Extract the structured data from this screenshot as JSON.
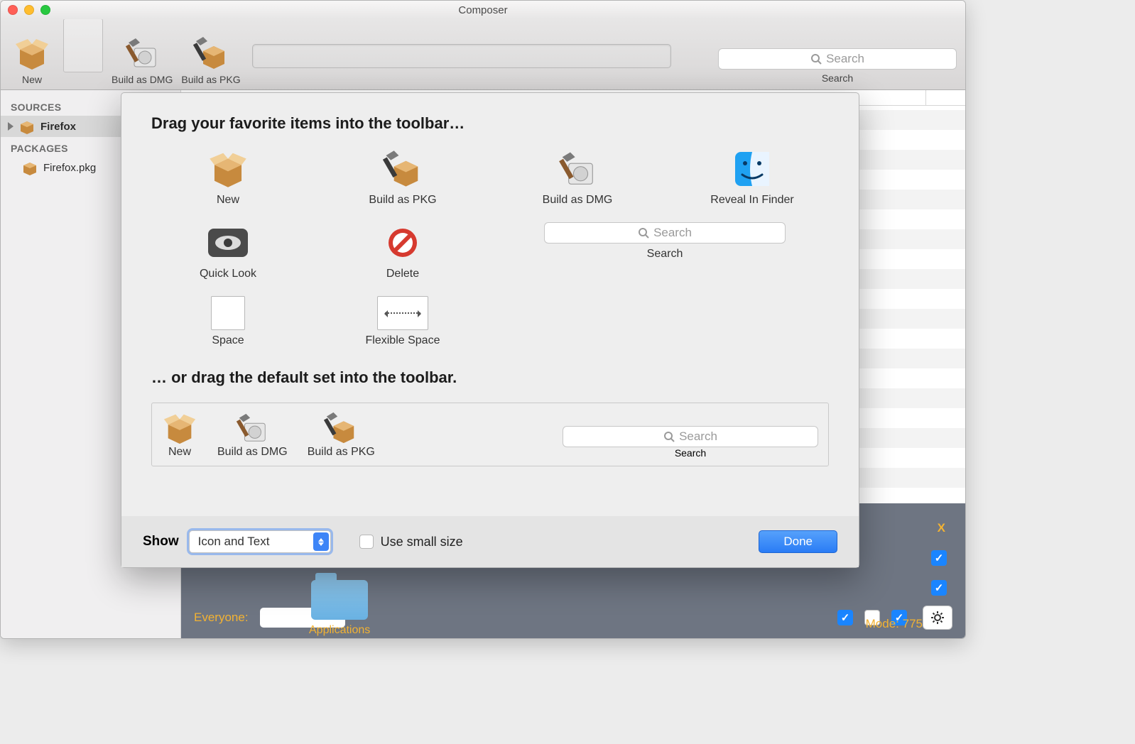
{
  "window": {
    "title": "Composer"
  },
  "toolbar": {
    "new": "New",
    "build_dmg": "Build as DMG",
    "build_pkg": "Build as PKG",
    "search_placeholder": "Search",
    "search_label": "Search"
  },
  "sidebar": {
    "sources_header": "SOURCES",
    "sources": [
      {
        "label": "Firefox"
      }
    ],
    "packages_header": "PACKAGES",
    "packages": [
      {
        "label": "Firefox.pkg"
      }
    ]
  },
  "sheet": {
    "heading1": "Drag your favorite items into the toolbar…",
    "palette": {
      "new": "New",
      "build_pkg": "Build as PKG",
      "build_dmg": "Build as DMG",
      "reveal": "Reveal In Finder",
      "quick_look": "Quick Look",
      "delete": "Delete",
      "search_placeholder": "Search",
      "search_label": "Search",
      "space": "Space",
      "flexible_space": "Flexible Space"
    },
    "heading2": "… or drag the default set into the toolbar.",
    "default_set": {
      "new": "New",
      "build_dmg": "Build as DMG",
      "build_pkg": "Build as PKG",
      "search_placeholder": "Search",
      "search_label": "Search"
    },
    "footer": {
      "show_label": "Show",
      "show_value": "Icon and Text",
      "small_size": "Use small size",
      "done": "Done"
    }
  },
  "owner_panel": {
    "everyone": "Everyone:",
    "mode_label": "Mode:",
    "mode_value": "775",
    "x": "X",
    "folder_label": "Applications"
  }
}
